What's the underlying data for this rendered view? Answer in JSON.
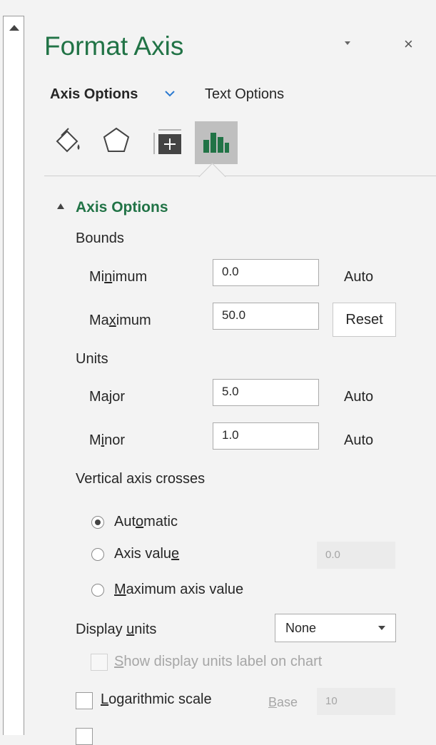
{
  "window": {
    "title": "Format Axis",
    "close_glyph": "×"
  },
  "tabs": {
    "axis_options": "Axis Options",
    "text_options": "Text Options"
  },
  "icons": [
    "fill-line-icon",
    "effects-icon",
    "size-properties-icon",
    "axis-options-icon"
  ],
  "colors": {
    "accent": "#217346",
    "link": "#2b79d0"
  },
  "section": {
    "title": "Axis Options",
    "bounds_label": "Bounds",
    "minimum": {
      "pre": "Mi",
      "ul": "n",
      "post": "imum",
      "value": "0.0",
      "mode": "Auto"
    },
    "maximum": {
      "pre": "Ma",
      "ul": "x",
      "post": "imum",
      "value": "50.0",
      "button": "Reset"
    },
    "units_label": "Units",
    "major": {
      "pre": "Ma",
      "ul": "j",
      "post": "or",
      "value": "5.0",
      "mode": "Auto"
    },
    "minor": {
      "pre": "M",
      "ul": "i",
      "post": "nor",
      "value": "1.0",
      "mode": "Auto"
    },
    "crosses_label": "Vertical axis crosses",
    "radio_automatic": {
      "pre": "Aut",
      "ul": "o",
      "post": "matic"
    },
    "radio_axis_value": {
      "pre": "Axis valu",
      "ul": "e",
      "post": "",
      "value": "0.0"
    },
    "radio_max": {
      "pre": "",
      "ul": "M",
      "post": "aximum axis value"
    },
    "display_units": {
      "pre": "Display ",
      "ul": "u",
      "post": "nits",
      "selected": "None"
    },
    "show_units_label": {
      "pre": "",
      "ul": "S",
      "post": "how display units label on chart"
    },
    "log_scale": {
      "pre": "",
      "ul": "L",
      "post": "ogarithmic scale"
    },
    "base": {
      "ul": "B",
      "post": "ase",
      "value": "10"
    }
  }
}
